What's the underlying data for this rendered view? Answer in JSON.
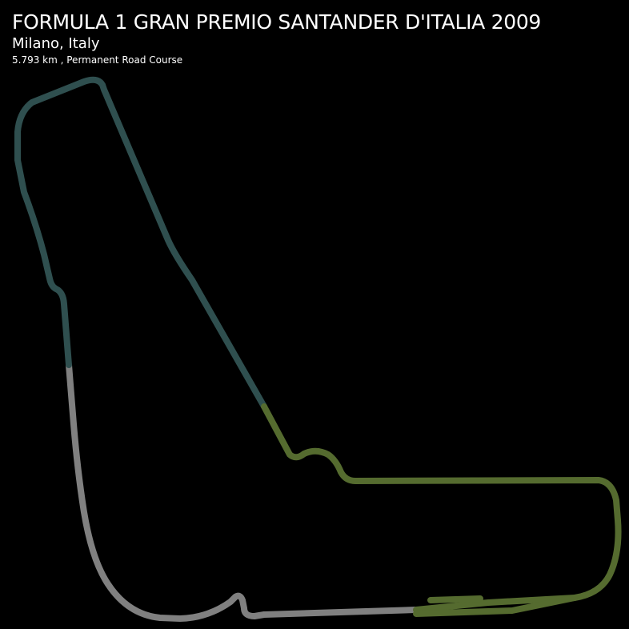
{
  "header": {
    "title": "FORMULA 1 GRAN PREMIO SANTANDER D'ITALIA 2009",
    "location": "Milano, Italy",
    "details": "5.793 km , Permanent Road Course"
  },
  "colors": {
    "background": "#000000",
    "text": "#ffffff",
    "sector1": "#808080",
    "sector2": "#556b2f",
    "sector3": "#2f4f4f"
  }
}
